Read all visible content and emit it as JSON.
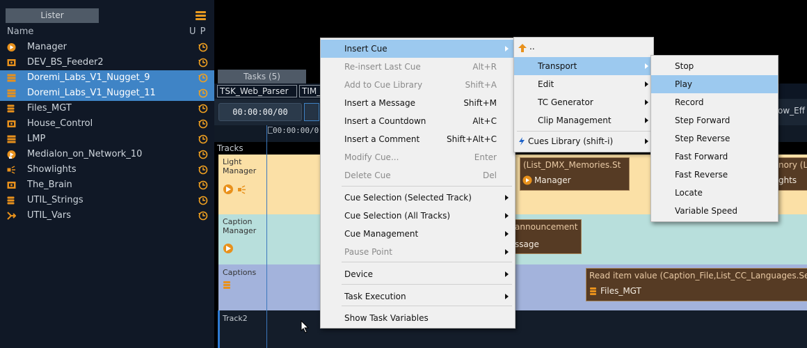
{
  "lister": {
    "tab_label": "Lister",
    "header_name": "Name",
    "header_u": "U",
    "header_p": "P",
    "items": [
      {
        "name": "Manager",
        "icon": "play-circle-icon",
        "selected": false
      },
      {
        "name": "DEV_BS_Feeder2",
        "icon": "device-icon",
        "selected": false
      },
      {
        "name": "Doremi_Labs_V1_Nugget_9",
        "icon": "stack-icon",
        "selected": true
      },
      {
        "name": "Doremi_Labs_V1_Nugget_11",
        "icon": "stack-icon",
        "selected": true
      },
      {
        "name": "Files_MGT",
        "icon": "database-icon",
        "selected": false
      },
      {
        "name": "House_Control",
        "icon": "device-icon",
        "selected": false
      },
      {
        "name": "LMP",
        "icon": "stack-icon",
        "selected": false
      },
      {
        "name": "Medialon_on_Network_10",
        "icon": "network-play-icon",
        "selected": false
      },
      {
        "name": "Showlights",
        "icon": "light-icon",
        "selected": false
      },
      {
        "name": "The_Brain",
        "icon": "device-icon",
        "selected": false
      },
      {
        "name": "UTIL_Strings",
        "icon": "database-icon",
        "selected": false
      },
      {
        "name": "UTIL_Vars",
        "icon": "variables-icon",
        "selected": false
      }
    ]
  },
  "tasks": {
    "tab_label": "Tasks (5)",
    "task_tabs": [
      "TSK_Web_Parser",
      "TIM_L"
    ],
    "timecode": "00:00:00/00",
    "ruler_time": "00:00:00/0",
    "tracks_label": "Tracks",
    "right_edge_text": "ow_Eff"
  },
  "tracks": [
    {
      "name": "Light\nManager"
    },
    {
      "name": "Caption\nManager"
    },
    {
      "name": "Captions"
    },
    {
      "name": "Track2"
    }
  ],
  "cues": {
    "light_cue_title": "(List_DMX_Memories.St",
    "light_cue_device": "Manager",
    "light_cue2_title": "nory (L",
    "light_cue2_device": "ghts",
    "caption_cue_title": "announcement",
    "caption_cue_device": "ssage",
    "captions_cue_title": "Read item value (Caption_File,List_CC_Languages.Sele",
    "captions_cue_device": "Files_MGT"
  },
  "menu_main": {
    "items": [
      {
        "label": "Insert Cue",
        "shortcut": "",
        "submenu": true,
        "disabled": false,
        "highlighted": true
      },
      {
        "label": "Re-insert Last Cue",
        "shortcut": "Alt+R",
        "submenu": false,
        "disabled": true
      },
      {
        "label": "Add to Cue Library",
        "shortcut": "Shift+A",
        "submenu": false,
        "disabled": true
      },
      {
        "label": "Insert a Message",
        "shortcut": "Shift+M",
        "submenu": false,
        "disabled": false
      },
      {
        "label": "Insert a Countdown",
        "shortcut": "Alt+C",
        "submenu": false,
        "disabled": false
      },
      {
        "label": "Insert a Comment",
        "shortcut": "Shift+Alt+C",
        "submenu": false,
        "disabled": false
      },
      {
        "label": "Modify Cue...",
        "shortcut": "Enter",
        "submenu": false,
        "disabled": true
      },
      {
        "label": "Delete Cue",
        "shortcut": "Del",
        "submenu": false,
        "disabled": true
      },
      {
        "label": "Cue Selection (Selected Track)",
        "shortcut": "",
        "submenu": true,
        "disabled": false
      },
      {
        "label": "Cue Selection (All Tracks)",
        "shortcut": "",
        "submenu": true,
        "disabled": false
      },
      {
        "label": "Cue Management",
        "shortcut": "",
        "submenu": true,
        "disabled": false
      },
      {
        "label": "Pause Point",
        "shortcut": "",
        "submenu": true,
        "disabled": true
      },
      {
        "label": "Device",
        "shortcut": "",
        "submenu": true,
        "disabled": false
      },
      {
        "label": "Task Execution",
        "shortcut": "",
        "submenu": true,
        "disabled": false
      },
      {
        "label": "Show Task Variables",
        "shortcut": "",
        "submenu": false,
        "disabled": false
      }
    ]
  },
  "menu_cue": {
    "up_label": "..",
    "items": [
      {
        "label": "Transport",
        "highlighted": true
      },
      {
        "label": "Edit"
      },
      {
        "label": "TC Generator"
      },
      {
        "label": "Clip Management"
      }
    ],
    "library_label": "Cues Library (shift-i)"
  },
  "menu_transport": {
    "items": [
      {
        "label": "Stop"
      },
      {
        "label": "Play",
        "highlighted": true
      },
      {
        "label": "Record"
      },
      {
        "label": "Step Forward"
      },
      {
        "label": "Step Reverse"
      },
      {
        "label": "Fast Forward"
      },
      {
        "label": "Fast Reverse"
      },
      {
        "label": "Locate"
      },
      {
        "label": "Variable Speed"
      }
    ]
  },
  "colors": {
    "light_track": "#fbe0a6",
    "caption_track": "#b8dfdc",
    "captions_track": "#a3b3dc",
    "track2": "#141d2a",
    "selection": "#3f84c6",
    "menu_highlight": "#9cc9ef",
    "history_icon": "#f0a020"
  }
}
